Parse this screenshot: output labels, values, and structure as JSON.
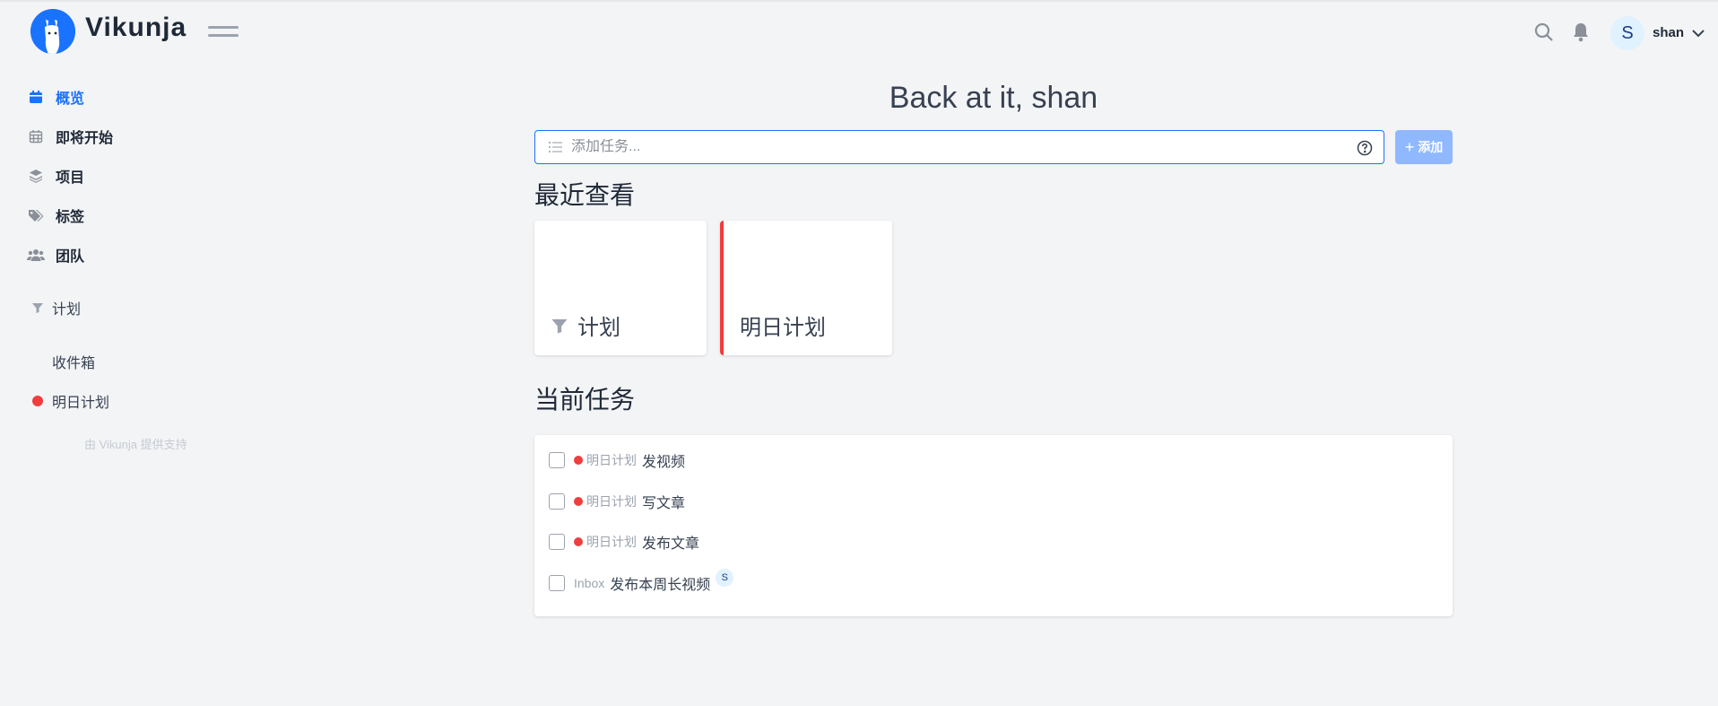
{
  "header": {
    "brand": "Vikunja",
    "user": {
      "initial": "S",
      "name": "shan"
    }
  },
  "sidebar": {
    "nav": [
      {
        "label": "概览",
        "icon": "calendar-icon",
        "active": true
      },
      {
        "label": "即将开始",
        "icon": "calendar-grid-icon",
        "active": false
      },
      {
        "label": "项目",
        "icon": "layers-icon",
        "active": false
      },
      {
        "label": "标签",
        "icon": "tags-icon",
        "active": false
      },
      {
        "label": "团队",
        "icon": "users-icon",
        "active": false
      }
    ],
    "projects": [
      {
        "label": "计划",
        "icon": "filter-icon"
      },
      {
        "label": "收件箱",
        "icon": ""
      },
      {
        "label": "明日计划",
        "icon": "red-dot",
        "color": "#f03e3e"
      }
    ],
    "powered_by": "由 Vikunja 提供支持"
  },
  "main": {
    "greeting": "Back at it, shan",
    "task_input": {
      "placeholder": "添加任务...",
      "add_label": "添加"
    },
    "recent_title": "最近查看",
    "recent_cards": [
      {
        "title": "计划",
        "icon": "filter-icon"
      },
      {
        "title": "明日计划",
        "border_color": "#f03e3e"
      }
    ],
    "current_title": "当前任务",
    "tasks": [
      {
        "project": "明日计划",
        "title": "发视频",
        "dot_color": "#f03e3e"
      },
      {
        "project": "明日计划",
        "title": "写文章",
        "dot_color": "#f03e3e"
      },
      {
        "project": "明日计划",
        "title": "发布文章",
        "dot_color": "#f03e3e"
      },
      {
        "project": "Inbox",
        "title": "发布本周长视频",
        "assignee": "S"
      }
    ]
  },
  "colors": {
    "accent": "#1973ff",
    "danger": "#f03e3e",
    "background": "#f3f4f6"
  }
}
